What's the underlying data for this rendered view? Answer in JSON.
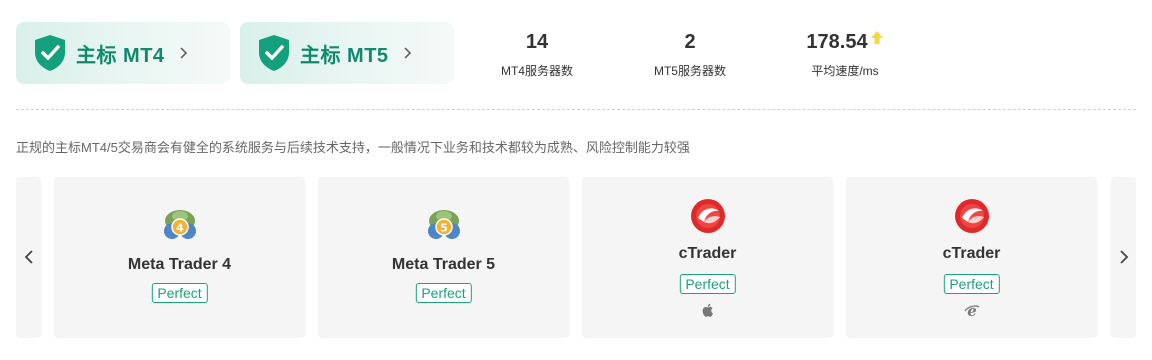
{
  "licenses": [
    {
      "label": "主标 MT4"
    },
    {
      "label": "主标 MT5"
    }
  ],
  "stats": [
    {
      "value": "14",
      "caption": "MT4服务器数"
    },
    {
      "value": "2",
      "caption": "MT5服务器数"
    },
    {
      "value": "178.54",
      "caption": "平均速度/ms"
    }
  ],
  "description": "正规的主标MT4/5交易商会有健全的系统服务与后续技术支持，一般情况下业务和技术都较为成熟、风险控制能力较强",
  "platforms": [
    {
      "name": "Meta Trader 4",
      "badge": "Perfect",
      "logo": "metatrader4-icon"
    },
    {
      "name": "Meta Trader 5",
      "badge": "Perfect",
      "logo": "metatrader5-icon"
    },
    {
      "name": "cTrader",
      "badge": "Perfect",
      "logo": "ctrader-icon",
      "os": "apple-icon"
    },
    {
      "name": "cTrader",
      "badge": "Perfect",
      "logo": "ctrader-icon",
      "os": "internet-explorer-icon"
    }
  ],
  "colors": {
    "accent": "#0f8a6d",
    "badge": "#1aa37a",
    "arrow_up": "#f5d742"
  }
}
